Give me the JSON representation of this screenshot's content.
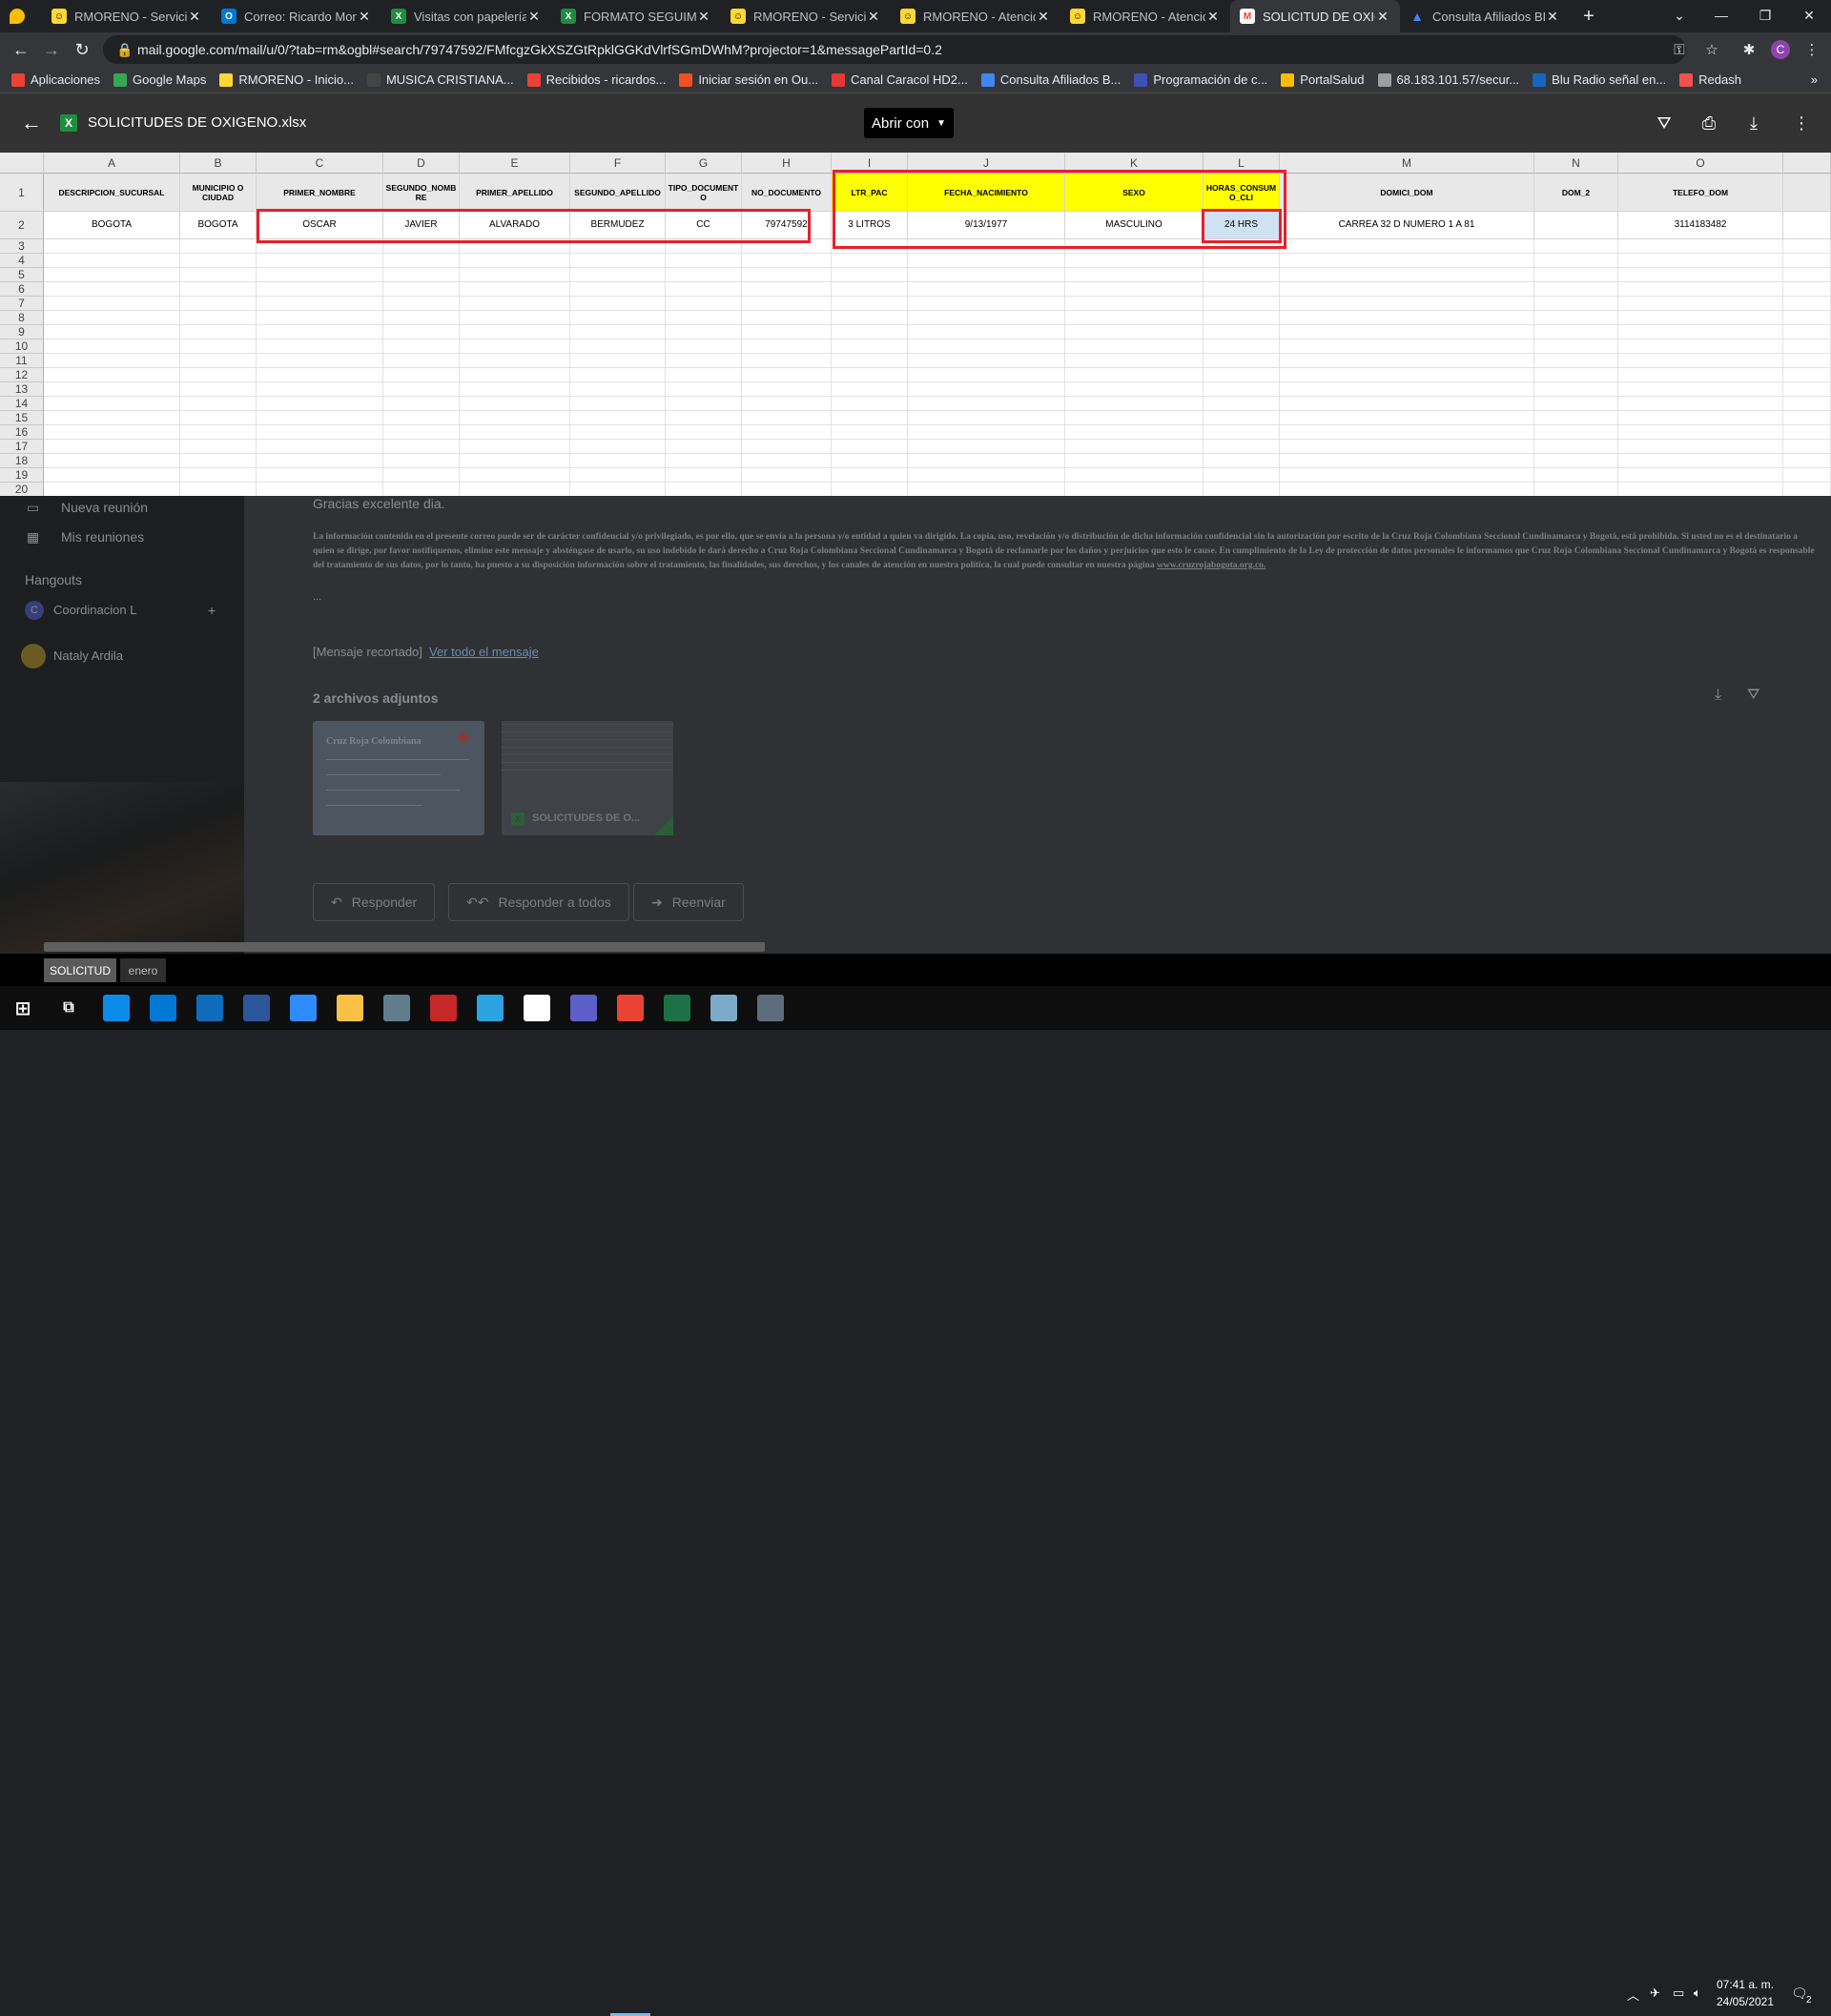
{
  "browser": {
    "tabs": [
      {
        "title": "",
        "favicon_color": "#fbbc04",
        "active": false
      },
      {
        "title": "RMORENO - Servicio",
        "favicon_color": "#fdd835",
        "active": false
      },
      {
        "title": "Correo: Ricardo More",
        "favicon_color": "#0078d4",
        "active": false
      },
      {
        "title": "Visitas con papelería",
        "favicon_color": "#1e8e3e",
        "active": false
      },
      {
        "title": "FORMATO SEGUIMIEN",
        "favicon_color": "#1e8e3e",
        "active": false
      },
      {
        "title": "RMORENO - Servicio",
        "favicon_color": "#fdd835",
        "active": false
      },
      {
        "title": "RMORENO - Atención",
        "favicon_color": "#fdd835",
        "active": false
      },
      {
        "title": "RMORENO - Atención",
        "favicon_color": "#fdd835",
        "active": false
      },
      {
        "title": "SOLICITUD DE OXIGE",
        "favicon_color": "#ea4335",
        "active": true
      },
      {
        "title": "Consulta Afiliados BD",
        "favicon_color": "#4285f4",
        "active": false
      }
    ],
    "new_tab_icon": "+",
    "url": "mail.google.com/mail/u/0/?tab=rm&ogbl#search/79747592/FMfcgzGkXSZGtRpklGGKdVlrfSGmDWhM?projector=1&messagePartId=0.2",
    "profile_initial": "C",
    "bookmarks": [
      {
        "label": "Aplicaciones",
        "color": "#ea4335"
      },
      {
        "label": "Google Maps",
        "color": "#34a853"
      },
      {
        "label": "RMORENO - Inicio...",
        "color": "#fdd835"
      },
      {
        "label": "MUSICA CRISTIANA...",
        "color": "#444444"
      },
      {
        "label": "Recibidos - ricardos...",
        "color": "#ea4335"
      },
      {
        "label": "Iniciar sesión en Ou...",
        "color": "#f25022"
      },
      {
        "label": "Canal Caracol HD2...",
        "color": "#e53935"
      },
      {
        "label": "Consulta Afiliados B...",
        "color": "#4285f4"
      },
      {
        "label": "Programación de c...",
        "color": "#3f51b5"
      },
      {
        "label": "PortalSalud",
        "color": "#fbbc04"
      },
      {
        "label": "68.183.101.57/secur...",
        "color": "#9e9e9e"
      },
      {
        "label": "Blu Radio señal en...",
        "color": "#1565c0"
      },
      {
        "label": "Redash",
        "color": "#ef5350"
      }
    ]
  },
  "preview": {
    "file_name": "SOLICITUDES DE OXIGENO.xlsx",
    "file_badge": "X",
    "open_with_label": "Abrir con"
  },
  "sheet": {
    "columns": [
      "A",
      "B",
      "C",
      "D",
      "E",
      "F",
      "G",
      "H",
      "I",
      "J",
      "K",
      "L",
      "M",
      "N",
      "O"
    ],
    "row_numbers": [
      "1",
      "2",
      "3",
      "4",
      "5",
      "6",
      "7",
      "8",
      "9",
      "10",
      "11",
      "12",
      "13",
      "14",
      "15",
      "16",
      "17",
      "18",
      "19",
      "20"
    ],
    "headers": [
      "DESCRIPCION_SUCURSAL",
      "MUNICIPIO O CIUDAD",
      "PRIMER_NOMBRE",
      "SEGUNDO_NOMB RE",
      "PRIMER_APELLIDO",
      "SEGUNDO_APELLIDO",
      "TIPO_DOCUMENT O",
      "NO_DOCUMENTO",
      "LTR_PAC",
      "FECHA_NACIMIENTO",
      "SEXO",
      "HORAS_CONSUM O_CLI",
      "DOMICI_DOM",
      "DOM_2",
      "TELEFO_DOM"
    ],
    "row2": [
      "BOGOTA",
      "BOGOTA",
      "OSCAR",
      "JAVIER",
      "ALVARADO",
      "BERMUDEZ",
      "CC",
      "79747592",
      "3 LITROS",
      "9/13/1977",
      "MASCULINO",
      "24 HRS",
      "CARREA 32 D NUMERO 1 A 81",
      "",
      "3114183482"
    ],
    "highlight_color": "#ffff00",
    "selected_cell_color": "#cfe2f3",
    "annotation_color": "#e8202a"
  },
  "gmail_background": {
    "side_items": [
      "Nueva reunión",
      "Mis reuniones"
    ],
    "hangouts_label": "Hangouts",
    "contacts": [
      "Coordinacion L",
      "Nataly Ardila"
    ],
    "thanks_line": "Gracias excelente dia.",
    "disclaimer": "La información contenida en el presente correo puede ser de carácter confidencial y/o privilegiado, es por ello, que se envía a la persona y/o entidad a quien va dirigido. La copia, uso, revelación y/o distribución de dicha información confidencial sin la autorización por escrito de la Cruz Roja Colombiana Seccional Cundinamarca y Bogotá, está prohibida. Si usted no es el destinatario a quien se dirige, por favor notifíquenos, elimine este mensaje y absténgase de usarlo, su uso indebido le dará derecho a Cruz Roja Colombiana Seccional Cundinamarca y Bogotá de reclamarle por los daños y perjuicios que esto le cause. En cumplimiento de la Ley de protección de datos personales le informamos que Cruz Roja Colombiana Seccional Cundinamarca y Bogotá es responsable del tratamiento de sus datos, por lo tanto, ha puesto a su disposición información sobre el tratamiento, las finalidades, sus derechos, y los canales de atención en nuestra política, la cual puede consultar en nuestra página",
    "disclaimer_link": "www.cruzrojabogota.org.co.",
    "ellipsis": "...",
    "clipped_label": "[Mensaje recortado]",
    "view_all_link": "Ver todo el mensaje",
    "attachments_label": "2 archivos adjuntos",
    "attachment_doc_title": "Cruz Roja Colombiana",
    "attachment_xlsx_name": "SOLICITUDES DE O...",
    "reply_label": "Responder",
    "reply_all_label": "Responder a todos",
    "forward_label": "Reenviar"
  },
  "sheet_tabs": [
    {
      "label": "SOLICITUD",
      "active": true
    },
    {
      "label": "enero",
      "active": false
    }
  ],
  "taskbar": {
    "time": "07:41 a. m.",
    "date": "24/05/2021",
    "notification_count": "2",
    "apps": [
      {
        "name": "edge",
        "color": "#0c8ce9"
      },
      {
        "name": "store",
        "color": "#0078d4"
      },
      {
        "name": "mail",
        "color": "#0f6cbd"
      },
      {
        "name": "word",
        "color": "#2b579a"
      },
      {
        "name": "zoom",
        "color": "#2d8cff"
      },
      {
        "name": "explorer",
        "color": "#f8c146"
      },
      {
        "name": "app-7",
        "color": "#607d8b"
      },
      {
        "name": "app-8",
        "color": "#c62828"
      },
      {
        "name": "telegram",
        "color": "#2aa3e0"
      },
      {
        "name": "app-10",
        "color": "#ffffff"
      },
      {
        "name": "teams",
        "color": "#5b5fc7"
      },
      {
        "name": "chrome",
        "color": "#ea4335"
      },
      {
        "name": "excel",
        "color": "#1e7145"
      },
      {
        "name": "app-14",
        "color": "#7eaac9"
      },
      {
        "name": "calculator",
        "color": "#5d6d7e"
      }
    ]
  }
}
